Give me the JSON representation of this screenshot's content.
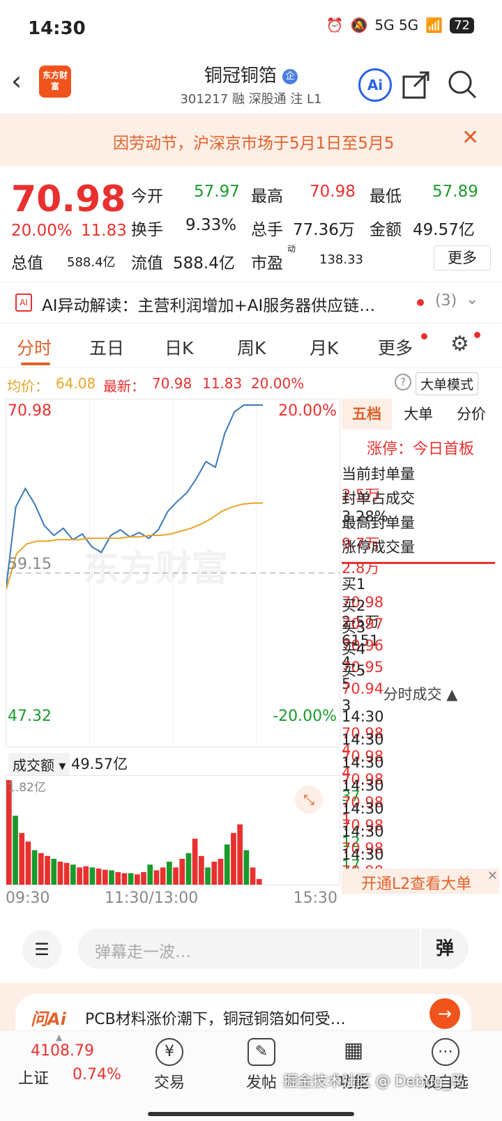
{
  "status_bar": {
    "time": "14:30",
    "signal": "5G 5G",
    "battery": "72"
  },
  "header": {
    "logo_text": "东方财富",
    "stock_name": "铜冠铜箔",
    "stock_code_line": "301217 融 深股通 注 L1",
    "ai_label": "Ai"
  },
  "notice": {
    "text": "因劳动节，沪深京市场于5月1日至5月5"
  },
  "quote": {
    "price": "70.98",
    "pct": "20.00%",
    "change": "11.83",
    "open_label": "今开",
    "open": "57.97",
    "high_label": "最高",
    "high": "70.98",
    "low_label": "最低",
    "low": "57.89",
    "turnover_label": "换手",
    "turnover": "9.33%",
    "volume_label": "总手",
    "volume": "77.36万",
    "amount_label": "金额",
    "amount": "49.57亿",
    "mktcap_label": "总值",
    "mktcap": "588.4亿",
    "float_label": "流值",
    "float": "588.4亿",
    "pe_label": "市盈",
    "pe_sup": "动",
    "pe": "138.33",
    "more": "更多"
  },
  "ai_line": {
    "text": "AI异动解读：主营利润增加+AI服务器供应链…",
    "count": "(3)"
  },
  "tabs": [
    "分时",
    "五日",
    "日K",
    "周K",
    "月K",
    "更多"
  ],
  "chart_info": {
    "avg_label": "均价：",
    "avg": "64.08",
    "latest_label": "最新：",
    "latest": "70.98",
    "chg": "11.83",
    "pct": "20.00%",
    "mode_btn": "大单模式"
  },
  "chart_labels": {
    "top_price": "70.98",
    "top_pct": "20.00%",
    "mid_price": "59.15",
    "bottom_price": "47.32",
    "bottom_pct": "-20.00%",
    "watermark": "东方财富",
    "vol_selector": "成交额",
    "vol_total": "49.57亿",
    "vol_max": "1.82亿",
    "time_start": "09:30",
    "time_mid": "11:30/13:00",
    "time_end": "15:30"
  },
  "chart_data": {
    "type": "line",
    "ylim": [
      47.32,
      70.98
    ],
    "prev_close": 59.15,
    "series": [],
    "price": [
      58.2,
      63.8,
      65.1,
      64.0,
      62.5,
      61.8,
      62.3,
      61.5,
      61.9,
      61.0,
      60.6,
      61.8,
      62.2,
      61.7,
      62.0,
      61.6,
      62.2,
      63.5,
      64.2,
      64.8,
      65.8,
      67.0,
      66.6,
      69.0,
      70.5,
      70.98,
      70.98,
      70.98
    ],
    "avg": [
      58.0,
      60.5,
      61.2,
      61.4,
      61.4,
      61.5,
      61.5,
      61.5,
      61.6,
      61.6,
      61.6,
      61.6,
      61.7,
      61.7,
      61.8,
      61.8,
      61.9,
      62.1,
      62.3,
      62.6,
      63.0,
      63.5,
      63.8,
      64.0,
      64.08,
      64.08
    ],
    "volume": [
      1.82,
      1.2,
      0.9,
      0.75,
      0.6,
      0.55,
      0.5,
      0.45,
      0.4,
      0.38,
      0.35,
      0.3,
      0.32,
      0.3,
      0.28,
      0.26,
      0.25,
      0.22,
      0.2,
      0.2,
      0.18,
      0.22,
      0.35,
      0.25,
      0.3,
      0.4,
      0.3,
      0.45,
      0.55,
      0.8,
      0.5,
      0.3,
      0.4,
      0.45,
      0.7,
      0.9,
      1.05,
      0.6,
      0.3,
      0.1
    ]
  },
  "panel": {
    "tabs": [
      "五档",
      "大单",
      "分价"
    ],
    "limit_title": "涨停：今日首板",
    "stats": [
      {
        "label": "当前封单量",
        "value": "2.5万"
      },
      {
        "label": "封单占成交",
        "value": "3.28%"
      },
      {
        "label": "最高封单量",
        "value": "9.7万"
      },
      {
        "label": "涨停成交量",
        "value": "2.8万"
      }
    ],
    "bids": [
      {
        "label": "买1",
        "price": "70.98",
        "vol": "2.5万"
      },
      {
        "label": "买2",
        "price": "70.97",
        "vol": "6151"
      },
      {
        "label": "买3",
        "price": "70.96",
        "vol": "4"
      },
      {
        "label": "买4",
        "price": "70.95",
        "vol": "5"
      },
      {
        "label": "买5",
        "price": "70.94",
        "vol": "3"
      }
    ],
    "ticks_title": "分时成交",
    "ticks": [
      {
        "time": "14:30",
        "price": "70.98",
        "vol": "4",
        "color": "red"
      },
      {
        "time": "14:30",
        "price": "70.98",
        "vol": "4",
        "color": "red"
      },
      {
        "time": "14:30",
        "price": "70.98",
        "vol": "37",
        "color": "green"
      },
      {
        "time": "14:30",
        "price": "70.98",
        "vol": "1",
        "color": "red"
      },
      {
        "time": "14:30",
        "price": "70.98",
        "vol": "12",
        "color": "green"
      },
      {
        "time": "14:30",
        "price": "70.98",
        "vol": "17",
        "color": "green"
      },
      {
        "time": "14:30",
        "price": "70.98",
        "vol": "1",
        "color": "green"
      }
    ],
    "l2": "开通L2查看大单"
  },
  "comment": {
    "placeholder": "弹幕走一波…",
    "btn": "弹"
  },
  "banner": {
    "logo": "问Ai",
    "text": "PCB材料涨价潮下，铜冠铜箔如何受…"
  },
  "nav": {
    "index_value": "4108.79",
    "index_name": "上证",
    "index_pct": "0.74%",
    "items": [
      "交易",
      "发帖",
      "功能",
      "设自选"
    ]
  },
  "watermark_footer": "掘金技术社区 @ Debug_马",
  "colors": {
    "up": "#e8312f",
    "down": "#1b9a2c",
    "accent": "#e0622a",
    "price_line": "#3a78b8",
    "avg_line": "#e6a52a"
  }
}
